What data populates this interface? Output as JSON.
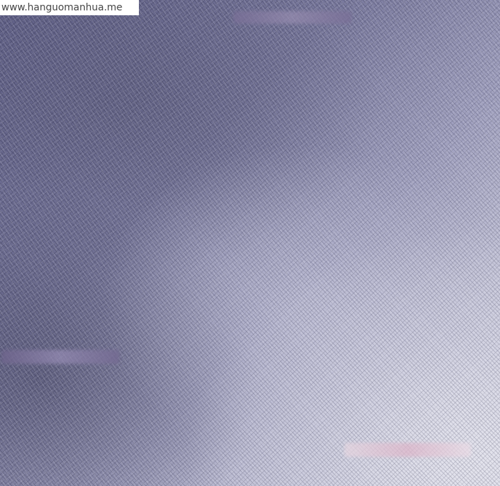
{
  "watermark": {
    "text": "www.hanguomanhua.me"
  },
  "colors": {
    "dark_corner": "#62628a",
    "mid_tone": "#a2a2c0",
    "light_corner": "#e2e2ea",
    "watermark_bg": "#ffffff"
  }
}
